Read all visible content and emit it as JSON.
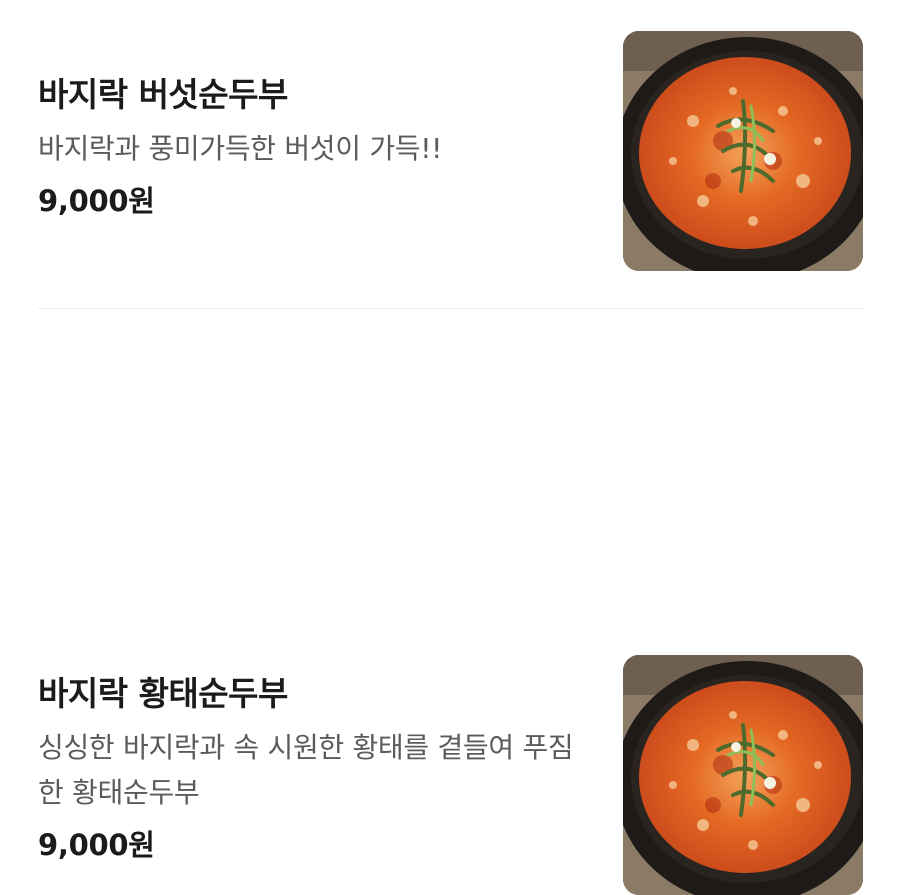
{
  "menu": {
    "items": [
      {
        "name": "바지락 버섯순두부",
        "description": "바지락과 풍미가득한 버섯이 가득!!",
        "price": "9,000원",
        "image_icon": "soondubu-stew-photo"
      },
      {
        "name": "바지락 황태순두부",
        "description": "싱싱한 바지락과 속 시원한 황태를 곁들여 푸짐한 황태순두부",
        "price": "9,000원",
        "image_icon": "soondubu-stew-photo"
      }
    ]
  },
  "colors": {
    "title": "#1b1b1b",
    "description": "#5b5b5b",
    "divider": "#ececec",
    "stew_broth": "#e0531e",
    "pot": "#1e1a17"
  }
}
